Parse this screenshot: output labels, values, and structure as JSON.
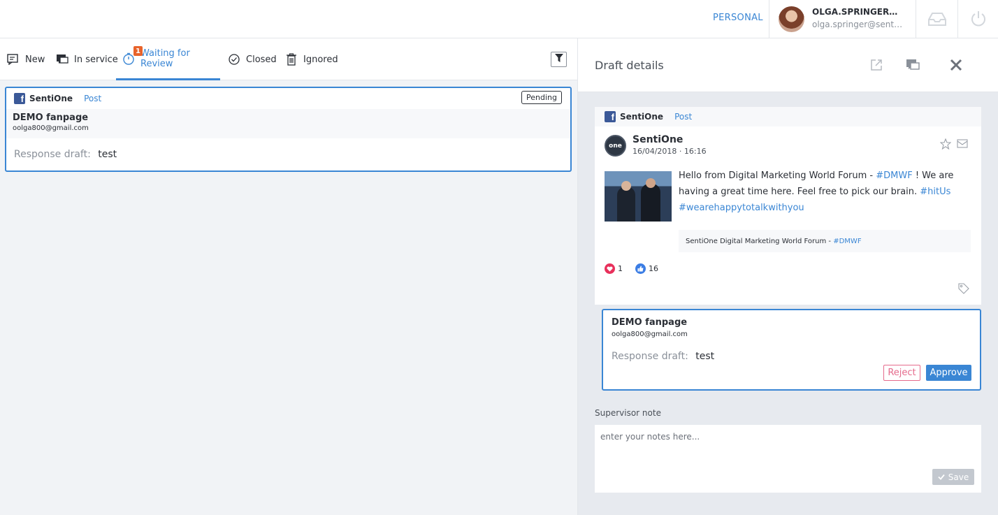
{
  "topbar": {
    "mode": "PERSONAL",
    "user_name": "OLGA.SPRINGER@SENTIONE.COM",
    "user_email": "olga.springer@sentione.com"
  },
  "tabs": [
    {
      "label": "New",
      "icon": "message-edit-icon"
    },
    {
      "label": "In service",
      "icon": "chat-icon"
    },
    {
      "label": "Waiting for Review",
      "icon": "stopwatch-icon",
      "badge": "1",
      "active": true
    },
    {
      "label": "Closed",
      "icon": "check-circle-icon"
    },
    {
      "label": "Ignored",
      "icon": "trash-icon"
    }
  ],
  "list_card": {
    "source": "SentiOne",
    "type": "Post",
    "status": "Pending",
    "author": "DEMO fanpage",
    "email": "oolga800@gmail.com",
    "draft_label": "Response draft:",
    "draft_value": "test"
  },
  "details": {
    "title": "Draft details",
    "post": {
      "source": "SentiOne",
      "type": "Post",
      "avatar_text": "one",
      "author": "SentiOne",
      "date": "16/04/2018 · 16:16",
      "text_1": "Hello from Digital Marketing World Forum - ",
      "hash_1": "#DMWF",
      "text_2": " ! We are having a great time here. Feel free to pick our brain. ",
      "hash_2": "#hitUs",
      "hash_3": "#wearehappytotalkwithyou",
      "preview_text": "SentiOne Digital Marketing World Forum - ",
      "preview_hash": "#DMWF",
      "love_count": "1",
      "like_count": "16"
    },
    "review": {
      "author": "DEMO fanpage",
      "email": "oolga800@gmail.com",
      "draft_label": "Response draft:",
      "draft_value": "test",
      "reject": "Reject",
      "approve": "Approve"
    },
    "supervisor": {
      "label": "Supervisor note",
      "placeholder": "enter your notes here...",
      "save": "Save"
    }
  },
  "colors": {
    "accent": "#3a86d4",
    "badge": "#e8632b",
    "reject": "#e56b8c",
    "facebook": "#3b5998"
  }
}
